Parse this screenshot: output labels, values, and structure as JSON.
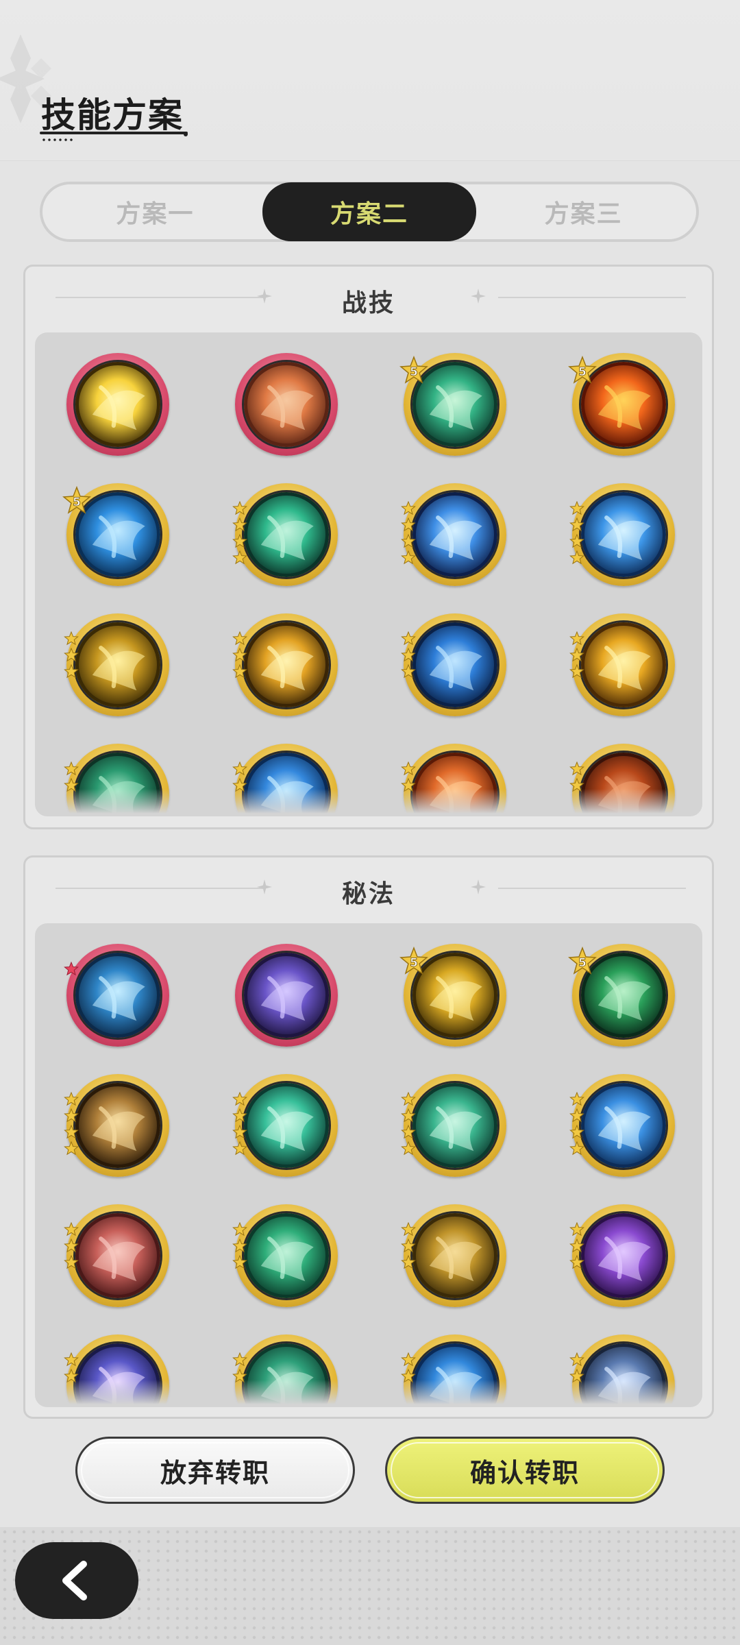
{
  "header": {
    "title": "技能方案"
  },
  "tabs": [
    {
      "label": "方案一",
      "active": false
    },
    {
      "label": "方案二",
      "active": true
    },
    {
      "label": "方案三",
      "active": false
    }
  ],
  "combat": {
    "title": "战技",
    "skills": [
      {
        "icon": "lightning-orb-icon",
        "frame": "red",
        "rank": null,
        "stars": 0,
        "colors": [
          "#3b2a05",
          "#f7d23c",
          "#fff6b0"
        ]
      },
      {
        "icon": "meteor-icon",
        "frame": "red",
        "rank": null,
        "stars": 0,
        "colors": [
          "#5a2414",
          "#e07a45",
          "#f6c8a0"
        ]
      },
      {
        "icon": "wind-orb-icon",
        "frame": "gold",
        "rank": "5",
        "stars": 0,
        "colors": [
          "#0d3a2c",
          "#33b385",
          "#c8f5d8"
        ]
      },
      {
        "icon": "fire-burst-icon",
        "frame": "gold",
        "rank": "5",
        "stars": 0,
        "colors": [
          "#5a1404",
          "#f2661b",
          "#ffd35a"
        ]
      },
      {
        "icon": "water-vortex-icon",
        "frame": "gold",
        "rank": "5",
        "stars": 0,
        "colors": [
          "#0a2f56",
          "#2f8fe0",
          "#bfe9ff"
        ]
      },
      {
        "icon": "wind-blades-icon",
        "frame": "gold",
        "rank": null,
        "stars": 4,
        "colors": [
          "#0b3328",
          "#2fb98c",
          "#c0f3dc"
        ]
      },
      {
        "icon": "ice-crystal-icon",
        "frame": "gold",
        "rank": null,
        "stars": 4,
        "colors": [
          "#0d1f4a",
          "#3f8fe6",
          "#d5f1ff"
        ]
      },
      {
        "icon": "ice-shatter-icon",
        "frame": "gold",
        "rank": null,
        "stars": 4,
        "colors": [
          "#0c2a55",
          "#3d96e8",
          "#d6f2ff"
        ]
      },
      {
        "icon": "golden-crystal-icon",
        "frame": "gold",
        "rank": null,
        "stars": 3,
        "colors": [
          "#3a2a05",
          "#c79820",
          "#fff0a0"
        ]
      },
      {
        "icon": "golden-slash-icon",
        "frame": "gold",
        "rank": null,
        "stars": 3,
        "colors": [
          "#3a2506",
          "#e3a324",
          "#fff3b0"
        ]
      },
      {
        "icon": "blue-flame-icon",
        "frame": "gold",
        "rank": null,
        "stars": 3,
        "colors": [
          "#0a2148",
          "#2e7ed8",
          "#bfe6ff"
        ]
      },
      {
        "icon": "golden-impact-icon",
        "frame": "gold",
        "rank": null,
        "stars": 3,
        "colors": [
          "#4a2a05",
          "#e8a822",
          "#fff2a8"
        ]
      },
      {
        "icon": "thorn-vine-icon",
        "frame": "gold",
        "rank": null,
        "stars": 2,
        "colors": [
          "#0d3326",
          "#2a9a70",
          "#a8e8c8"
        ]
      },
      {
        "icon": "ice-wave-icon",
        "frame": "gold",
        "rank": null,
        "stars": 2,
        "colors": [
          "#0a2a55",
          "#3488dd",
          "#c4ebff"
        ]
      },
      {
        "icon": "fire-swirl-icon",
        "frame": "gold",
        "rank": null,
        "stars": 2,
        "colors": [
          "#5a1a06",
          "#e06a2a",
          "#ffc890"
        ]
      },
      {
        "icon": "flame-tail-icon",
        "frame": "gold",
        "rank": null,
        "stars": 2,
        "colors": [
          "#3a1208",
          "#b8481a",
          "#f0a070"
        ]
      }
    ]
  },
  "arcane": {
    "title": "秘法",
    "skills": [
      {
        "icon": "water-drop-icon",
        "frame": "red",
        "rank": null,
        "stars": 1,
        "colors": [
          "#0c2a4a",
          "#2f86c8",
          "#c4ecff"
        ]
      },
      {
        "icon": "arcane-clock-icon",
        "frame": "red",
        "rank": null,
        "stars": 0,
        "colors": [
          "#1e1540",
          "#6a55c8",
          "#d6c8ff"
        ]
      },
      {
        "icon": "golden-aura-icon",
        "frame": "gold",
        "rank": "5",
        "stars": 0,
        "colors": [
          "#3a2a05",
          "#d9a923",
          "#fff0a0"
        ]
      },
      {
        "icon": "green-leaf-icon",
        "frame": "gold",
        "rank": "5",
        "stars": 0,
        "colors": [
          "#0a2a1a",
          "#2aa05a",
          "#b8f0c8"
        ]
      },
      {
        "icon": "golden-wand-icon",
        "frame": "gold",
        "rank": null,
        "stars": 4,
        "colors": [
          "#2a1a08",
          "#b0803a",
          "#f6dca0"
        ]
      },
      {
        "icon": "green-spirit-icon",
        "frame": "gold",
        "rank": null,
        "stars": 4,
        "colors": [
          "#0b3a30",
          "#38c09a",
          "#c8f7e6"
        ]
      },
      {
        "icon": "green-shield-icon",
        "frame": "gold",
        "rank": null,
        "stars": 4,
        "colors": [
          "#0c3a2e",
          "#3ab58e",
          "#c8f5e2"
        ]
      },
      {
        "icon": "ice-feather-icon",
        "frame": "gold",
        "rank": null,
        "stars": 4,
        "colors": [
          "#0c2c58",
          "#3b90e2",
          "#d2f0ff"
        ]
      },
      {
        "icon": "crimson-mist-icon",
        "frame": "gold",
        "rank": null,
        "stars": 3,
        "colors": [
          "#4a1818",
          "#c8605a",
          "#f8c8c0"
        ]
      },
      {
        "icon": "green-heart-icon",
        "frame": "gold",
        "rank": null,
        "stars": 3,
        "colors": [
          "#0b3a2a",
          "#2fae7a",
          "#c0f2d8"
        ]
      },
      {
        "icon": "golden-fist-icon",
        "frame": "gold",
        "rank": null,
        "stars": 3,
        "colors": [
          "#3a2a08",
          "#c0942a",
          "#f5dc98"
        ]
      },
      {
        "icon": "violet-rune-icon",
        "frame": "gold",
        "rank": null,
        "stars": 3,
        "colors": [
          "#2a1048",
          "#8a4ad0",
          "#e2c8ff"
        ]
      },
      {
        "icon": "starry-night-icon",
        "frame": "gold",
        "rank": null,
        "stars": 2,
        "colors": [
          "#1a1a48",
          "#5a58c8",
          "#e8d8ff"
        ]
      },
      {
        "icon": "green-tide-icon",
        "frame": "gold",
        "rank": null,
        "stars": 2,
        "colors": [
          "#0c3a2c",
          "#2ea07a",
          "#c0ecd8"
        ]
      },
      {
        "icon": "water-swirl-icon",
        "frame": "gold",
        "rank": null,
        "stars": 2,
        "colors": [
          "#0a2a58",
          "#3288dc",
          "#c6eaff"
        ]
      },
      {
        "icon": "prism-peak-icon",
        "frame": "gold",
        "rank": null,
        "stars": 2,
        "colors": [
          "#18243a",
          "#5a7ab0",
          "#d8e8ff"
        ]
      }
    ]
  },
  "actions": {
    "abandon": "放弃转职",
    "confirm": "确认转职"
  },
  "nav": {
    "back": "back-arrow-icon"
  }
}
